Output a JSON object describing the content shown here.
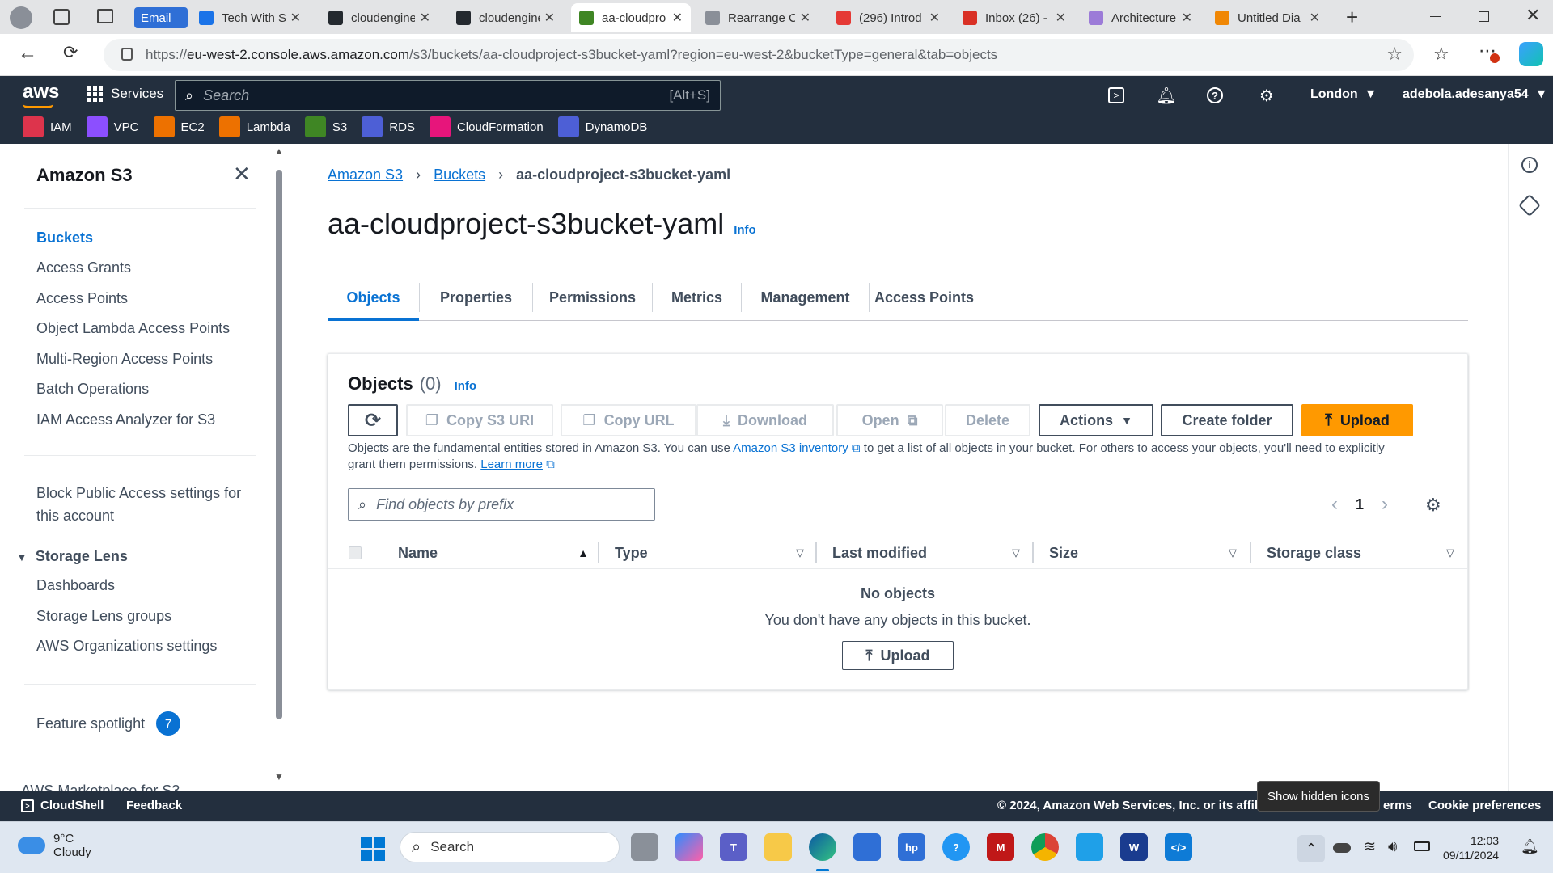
{
  "browser": {
    "tabs": [
      {
        "label": "Email",
        "icon": "email-icon",
        "color": "#2f6fd6"
      },
      {
        "label": "Tech With S",
        "icon": "tech-icon",
        "color": "#1a73e8"
      },
      {
        "label": "cloudengine",
        "icon": "github-icon",
        "color": "#24292f"
      },
      {
        "label": "cloudengine",
        "icon": "github-icon",
        "color": "#24292f"
      },
      {
        "label": "aa-cloudpro",
        "icon": "s3-icon",
        "color": "#3f8624"
      },
      {
        "label": "Rearrange C",
        "icon": "globe-icon",
        "color": "#8a8f98"
      },
      {
        "label": "(296) Introd",
        "icon": "youtube-icon",
        "color": "#e53935"
      },
      {
        "label": "Inbox (26) -",
        "icon": "gmail-icon",
        "color": "#d93025"
      },
      {
        "label": "Architecture",
        "icon": "diagram-icon",
        "color": "#9c7bd8"
      },
      {
        "label": "Untitled Dia",
        "icon": "drawio-icon",
        "color": "#f08705"
      }
    ],
    "url_prefix": "https://",
    "url_host": "eu-west-2.console.aws.amazon.com",
    "url_path": "/s3/buckets/aa-cloudproject-s3bucket-yaml?region=eu-west-2&bucketType=general&tab=objects"
  },
  "aws_header": {
    "logo": "aws",
    "services_label": "Services",
    "search_placeholder": "Search",
    "search_shortcut": "[Alt+S]",
    "region": "London",
    "account": "adebola.adesanya54",
    "favorites": [
      {
        "label": "IAM",
        "color": "#dd344c"
      },
      {
        "label": "VPC",
        "color": "#8c4fff"
      },
      {
        "label": "EC2",
        "color": "#ed7100"
      },
      {
        "label": "Lambda",
        "color": "#ed7100"
      },
      {
        "label": "S3",
        "color": "#3f8624"
      },
      {
        "label": "RDS",
        "color": "#4d5fd6"
      },
      {
        "label": "CloudFormation",
        "color": "#e7157b"
      },
      {
        "label": "DynamoDB",
        "color": "#4d5fd6"
      }
    ]
  },
  "sidebar": {
    "title": "Amazon S3",
    "items": [
      "Buckets",
      "Access Grants",
      "Access Points",
      "Object Lambda Access Points",
      "Multi-Region Access Points",
      "Batch Operations",
      "IAM Access Analyzer for S3"
    ],
    "block_public_line1": "Block Public Access settings for",
    "block_public_line2": "this account",
    "storage_lens": "Storage Lens",
    "storage_lens_items": [
      "Dashboards",
      "Storage Lens groups",
      "AWS Organizations settings"
    ],
    "feature_spotlight": "Feature spotlight",
    "feature_count": "7",
    "marketplace": "AWS Marketplace for S3"
  },
  "main": {
    "breadcrumb": [
      "Amazon S3",
      "Buckets",
      "aa-cloudproject-s3bucket-yaml"
    ],
    "title": "aa-cloudproject-s3bucket-yaml",
    "info": "Info",
    "tabs": [
      "Objects",
      "Properties",
      "Permissions",
      "Metrics",
      "Management",
      "Access Points"
    ],
    "objects_title": "Objects",
    "objects_count": "(0)",
    "objects_info": "Info",
    "buttons": {
      "copy_s3_uri": "Copy S3 URI",
      "copy_url": "Copy URL",
      "download": "Download",
      "open": "Open",
      "delete": "Delete",
      "actions": "Actions",
      "create_folder": "Create folder",
      "upload": "Upload"
    },
    "desc_part1": "Objects are the fundamental entities stored in Amazon S3. You can use ",
    "desc_link1": "Amazon S3 inventory",
    "desc_part2": " to get a list of all objects in your bucket. For others to access your objects, you'll need to explicitly",
    "desc_line2": "grant them permissions. ",
    "desc_link2": "Learn more",
    "filter_placeholder": "Find objects by prefix",
    "page_number": "1",
    "columns": [
      "Name",
      "Type",
      "Last modified",
      "Size",
      "Storage class"
    ],
    "empty_title": "No objects",
    "empty_text": "You don't have any objects in this bucket.",
    "empty_upload": "Upload"
  },
  "footer": {
    "cloudshell": "CloudShell",
    "feedback": "Feedback",
    "copyright": "© 2024, Amazon Web Services, Inc. or its affiliat",
    "terms": "erms",
    "cookie": "Cookie preferences",
    "tooltip": "Show hidden icons"
  },
  "taskbar": {
    "temp": "9°C",
    "weather": "Cloudy",
    "search": "Search",
    "time": "12:03",
    "date": "09/11/2024"
  },
  "colors": {
    "aws_dark": "#232f3e",
    "link": "#0972d3",
    "primary": "#ff9900"
  }
}
